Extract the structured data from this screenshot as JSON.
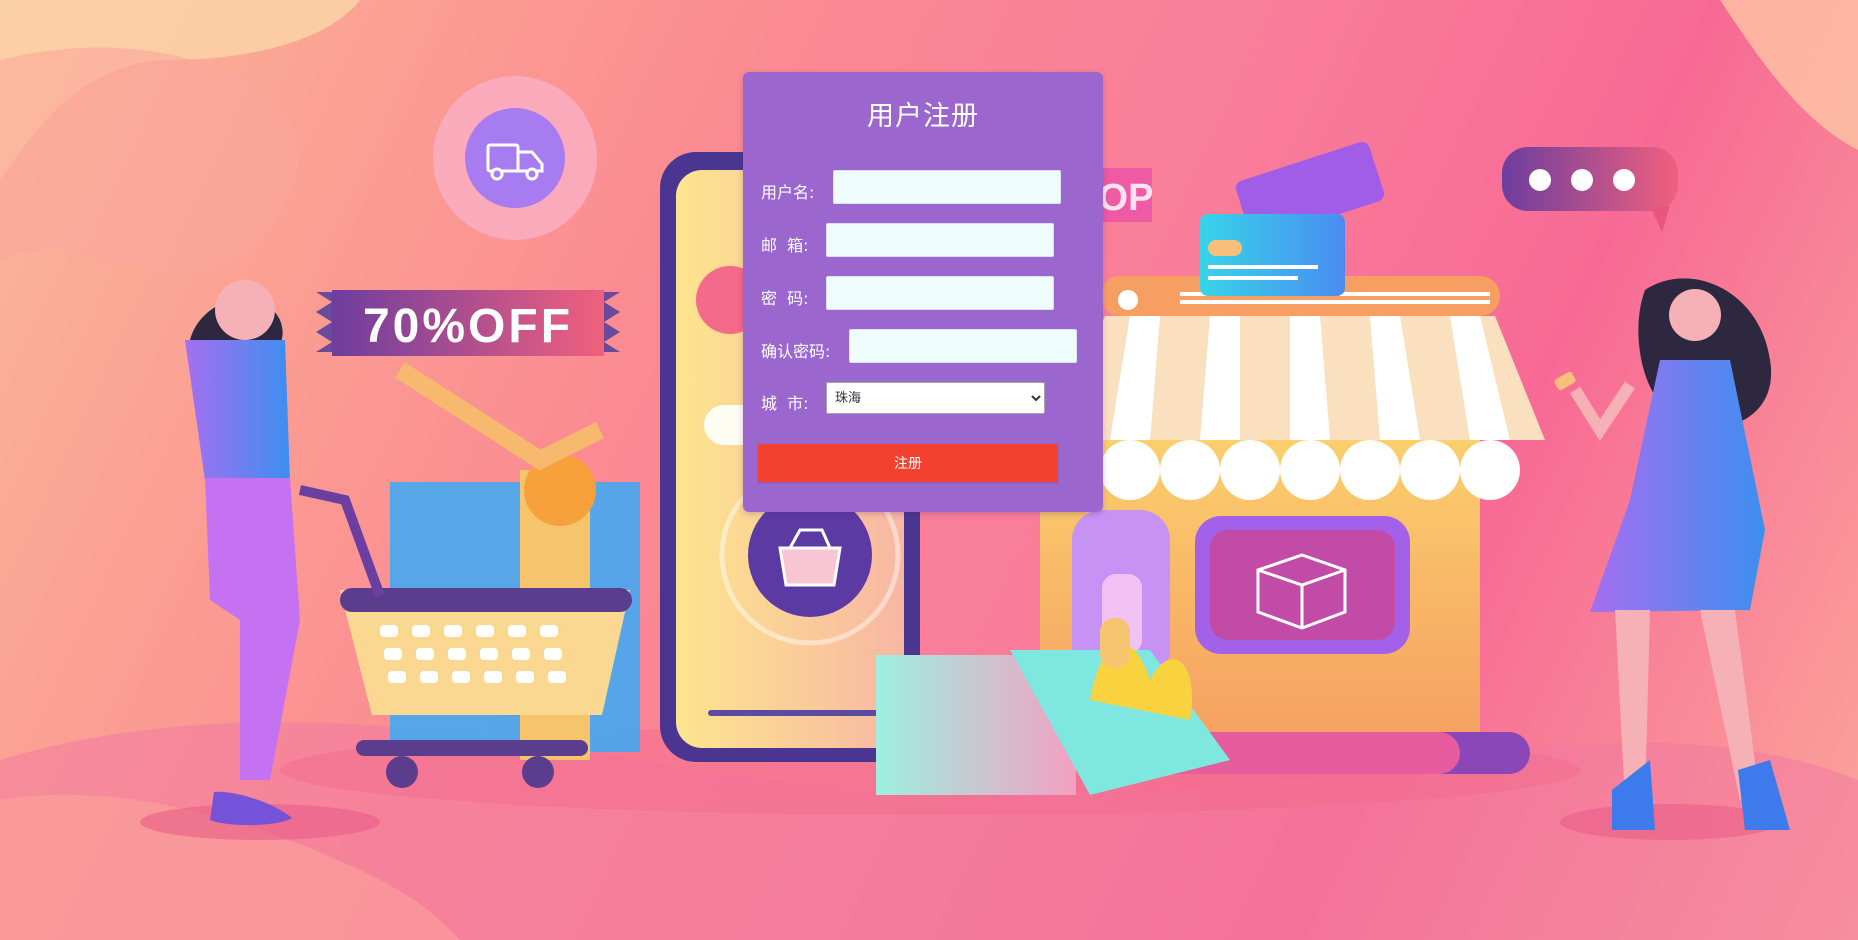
{
  "form": {
    "title": "用户注册",
    "fields": {
      "username": {
        "label": "用户名:",
        "value": ""
      },
      "email": {
        "label": "邮  箱:",
        "value": ""
      },
      "password": {
        "label": "密  码:",
        "value": ""
      },
      "confirm_password": {
        "label": "确认密码:",
        "value": ""
      },
      "city": {
        "label": "城  市:",
        "selected": "珠海"
      }
    },
    "submit_label": "注册"
  },
  "background": {
    "banner_text": "70%OFF",
    "shop_sign_text": "OP",
    "colors": {
      "panel": "#9b67cf",
      "submit": "#f2412f",
      "input_bg": "#effdfe"
    }
  }
}
